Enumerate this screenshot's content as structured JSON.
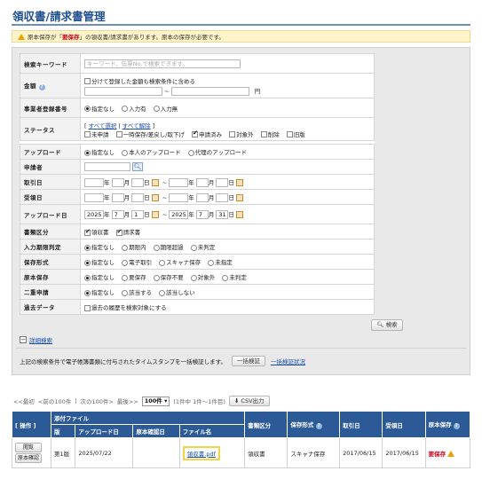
{
  "page": {
    "title": "領収書/請求書管理",
    "notice_prefix": "原本保存が「",
    "notice_em": "要保存",
    "notice_suffix": "」の領収書/請求書があります。原本の保存が必要です。"
  },
  "search": {
    "keyword_label": "検索キーワード",
    "keyword_placeholder": "キーワード、伝票No.で検索できます。",
    "amount_label": "金額",
    "amount_split": "分けて登録した金額も検索条件に含める",
    "amount_tilde": "~",
    "amount_unit": "円",
    "bizreg_label": "事業者登録番号",
    "bizreg_options": [
      "指定なし",
      "入力有",
      "入力無"
    ],
    "status_label": "ステータス",
    "status_select_all": "すべて選択",
    "status_clear_all": "すべて解除",
    "status_bracket_open": "[",
    "status_bar": "|",
    "status_bracket_close": "]",
    "status_options": [
      "未申請",
      "一時保存/差戻し/取下げ",
      "申請済み",
      "対象外",
      "削除",
      "旧版"
    ],
    "upload_label": "アップロード",
    "upload_options": [
      "指定なし",
      "本人のアップロード",
      "代理のアップロード"
    ],
    "applicant_label": "申請者",
    "txn_date_label": "取引日",
    "recv_date_label": "受領日",
    "upload_date_label": "アップロード日",
    "date_year": "年",
    "date_month": "月",
    "date_day": "日",
    "date_tilde": "~",
    "upload_from": {
      "y": "2025",
      "m": "7",
      "d": "1"
    },
    "upload_to": {
      "y": "2025",
      "m": "7",
      "d": "31"
    },
    "doc_type_label": "書類区分",
    "doc_type_options": [
      "領収書",
      "請求書"
    ],
    "deadline_label": "入力期限判定",
    "deadline_options": [
      "指定なし",
      "期限内",
      "期限超過",
      "未判定"
    ],
    "storage_label": "保存形式",
    "storage_options": [
      "指定なし",
      "電子取引",
      "スキャナ保存",
      "未指定"
    ],
    "original_label": "原本保存",
    "original_options": [
      "指定なし",
      "要保存",
      "保存不要",
      "対象外",
      "未判定"
    ],
    "double_label": "二重申請",
    "double_options": [
      "指定なし",
      "該当する",
      "該当しない"
    ],
    "past_label": "過去データ",
    "past_option": "過去の履歴を検索対象にする",
    "search_button": "検索",
    "detail_toggle": "−",
    "detail_link": "詳細検索",
    "timestamp_text": "上記の検索条件で電子帳簿書類に付与されたタイムスタンプを一括検証します。",
    "bulk_verify": "一括検証",
    "bulk_status": "一括検証状況"
  },
  "pager": {
    "first": "<<最初",
    "prev": "<前の100件",
    "sep": "|",
    "next": "次の100件>",
    "last": "最後>>",
    "per_page": "100件",
    "count": "(1件中 1件〜1件目)",
    "csv": "CSV出力"
  },
  "results": {
    "headers": {
      "ops": "[ 操作 ]",
      "attached": "添付ファイル",
      "version": "版",
      "upload_date": "アップロード日",
      "orig_reg": "原本確認日",
      "filename": "ファイル名",
      "doc_type": "書類区分",
      "storage": "保存形式",
      "txn_date": "取引日",
      "recv_date": "受領日",
      "original": "原本保存"
    },
    "row": {
      "btn_view": "閲覧",
      "btn_confirm": "原本確認",
      "version": "第1版",
      "upload_date": "2025/07/22",
      "orig_reg": "",
      "filename": "領収書.pdf",
      "doc_type": "領収書",
      "storage": "スキャナ保存",
      "txn_date": "2017/06/15",
      "recv_date": "2017/06/15",
      "original": "要保存"
    }
  }
}
